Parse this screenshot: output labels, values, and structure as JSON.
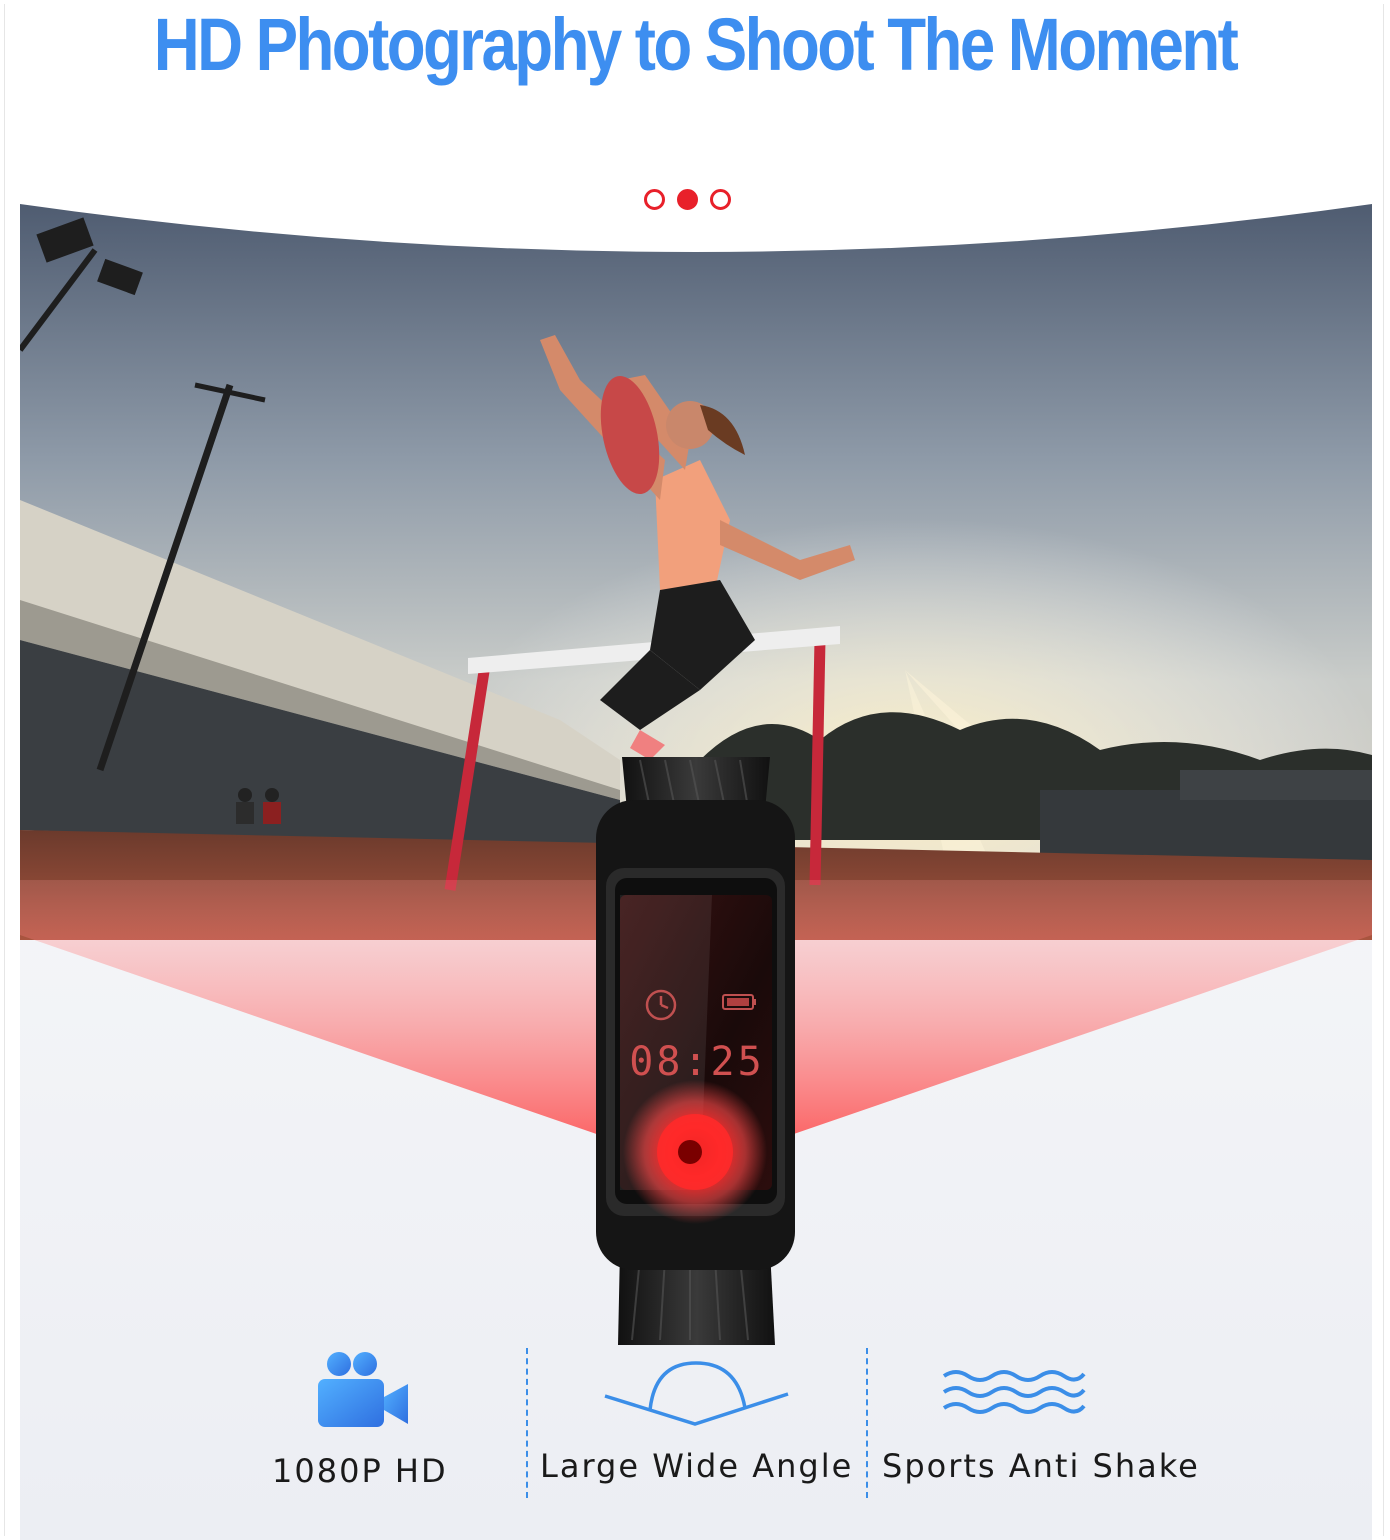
{
  "headline": "HD Photography to Shoot The Moment",
  "carousel": {
    "dot_count": 3,
    "active_index": 1
  },
  "watch": {
    "time": "08:25"
  },
  "features": [
    {
      "label": "1080P HD",
      "icon": "video-camera-icon"
    },
    {
      "label": "Large Wide Angle",
      "icon": "wide-angle-icon"
    },
    {
      "label": "Sports Anti Shake",
      "icon": "waves-icon"
    }
  ],
  "colors": {
    "headline_blue": "#3d8ef0",
    "accent_red": "#e8202a",
    "icon_blue": "#3b8ee8"
  }
}
